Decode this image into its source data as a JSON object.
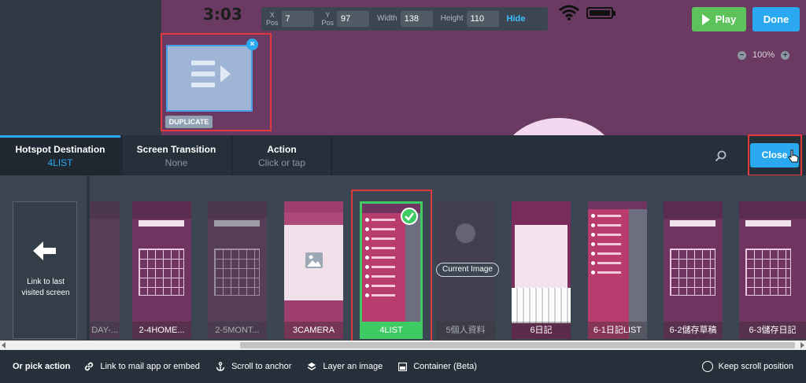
{
  "editor": {
    "phone_time": "3:03",
    "position_bar": {
      "x_label": [
        "X",
        "Pos"
      ],
      "x_value": "7",
      "y_label": [
        "Y",
        "Pos"
      ],
      "y_value": "97",
      "width_label": "Width",
      "width_value": "138",
      "height_label": "Height",
      "height_value": "110",
      "hide_label": "Hide"
    },
    "play_label": "Play",
    "done_label": "Done",
    "zoom_minus": "−",
    "zoom_value": "100%",
    "zoom_plus": "+",
    "hotspot_close": "×",
    "duplicate_label": "DUPLICATE"
  },
  "tabs": [
    {
      "title": "Hotspot Destination",
      "subtitle": "4LIST"
    },
    {
      "title": "Screen Transition",
      "subtitle": "None"
    },
    {
      "title": "Action",
      "subtitle": "Click or tap"
    }
  ],
  "close_label": "Close",
  "link_last_label": "Link to last visited screen",
  "screens": [
    {
      "label": "DAY-..."
    },
    {
      "label": "2-4HOME..."
    },
    {
      "label": "2-5MONT..."
    },
    {
      "label": "3CAMERA"
    },
    {
      "label": "4LIST"
    },
    {
      "label": "5個人資料"
    },
    {
      "label": "6日記"
    },
    {
      "label": "6-1日記LIST"
    },
    {
      "label": "6-2儲存草稿"
    },
    {
      "label": "6-3儲存日記"
    }
  ],
  "current_image_label": "Current Image",
  "actions": {
    "or_pick": "Or pick action",
    "mail": "Link to mail app or embed",
    "anchor": "Scroll to anchor",
    "layer": "Layer an image",
    "container": "Container (Beta)",
    "keep_scroll": "Keep scroll position"
  },
  "colors": {
    "accent": "#2aa9f0",
    "play": "#5cc25a",
    "selected": "#3fcb63",
    "highlight": "#e03a3a",
    "screen_bg": "#6f3560"
  },
  "icons": [
    "wifi-icon",
    "battery-icon",
    "play-icon",
    "hotspot-list-icon",
    "search-icon",
    "hand-cursor-icon",
    "back-arrow-icon",
    "check-icon",
    "link-icon",
    "anchor-icon",
    "layers-icon",
    "container-icon"
  ]
}
